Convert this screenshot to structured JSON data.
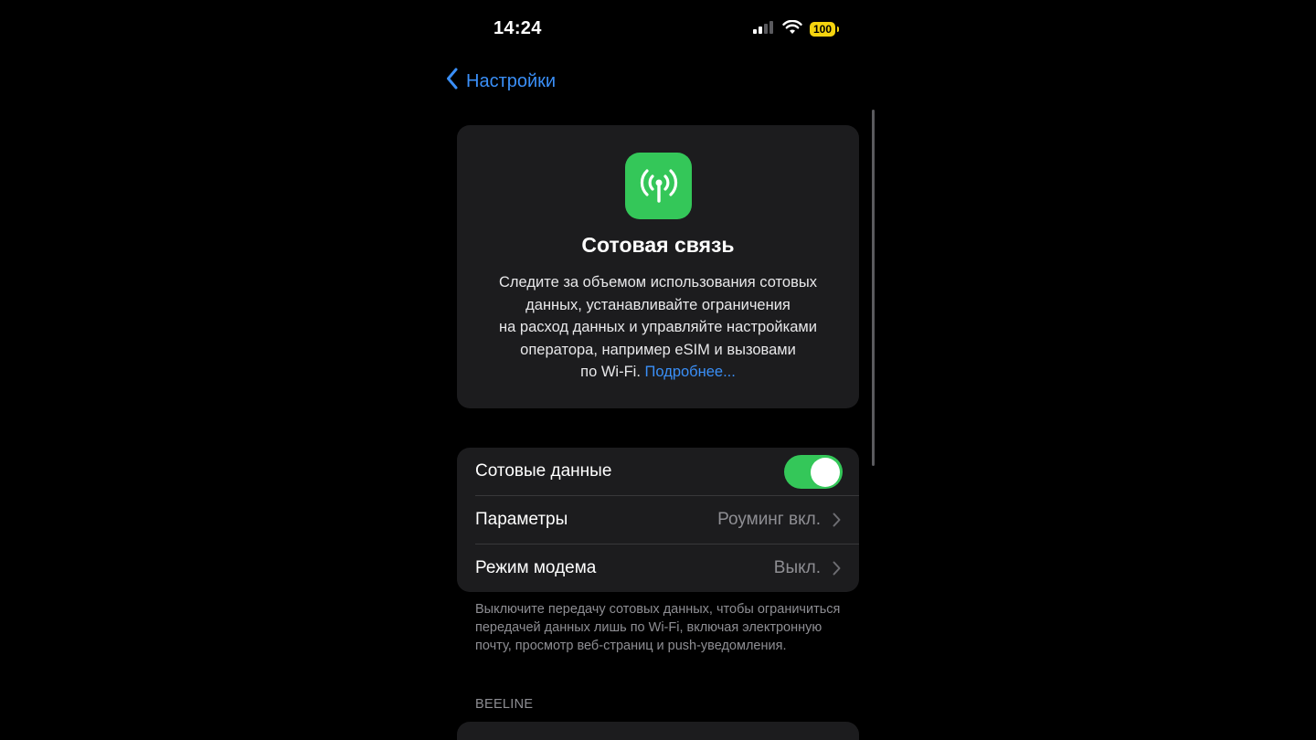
{
  "status_bar": {
    "time": "14:24",
    "battery": "100",
    "signal_icon": "cellular-signal-icon",
    "wifi_icon": "wifi-icon"
  },
  "nav": {
    "back_label": "Настройки",
    "back_icon": "chevron-left-icon"
  },
  "info_card": {
    "icon": "antenna-icon",
    "icon_color": "#34c759",
    "title": "Сотовая связь",
    "description_lines": [
      "Следите за объемом использования сотовых",
      "данных, устанавливайте ограничения",
      "на расход данных и управляйте настройками",
      "оператора, например eSIM и вызовами"
    ],
    "description_last": "по Wi-Fi.",
    "more_link": "Подробнее..."
  },
  "settings": {
    "cellular_data": {
      "label": "Сотовые данные",
      "enabled": true
    },
    "options": {
      "label": "Параметры",
      "value": "Роуминг вкл."
    },
    "hotspot": {
      "label": "Режим модема",
      "value": "Выкл."
    }
  },
  "footer_note": "Выключите передачу сотовых данных, чтобы ограничиться передачей данных лишь по Wi-Fi, включая электронную почту, просмотр веб-страниц и push-уведомления.",
  "section_header": "BEELINE",
  "colors": {
    "accent": "#3a8ff7",
    "toggle_on": "#34c759",
    "battery": "#f5d40f"
  }
}
